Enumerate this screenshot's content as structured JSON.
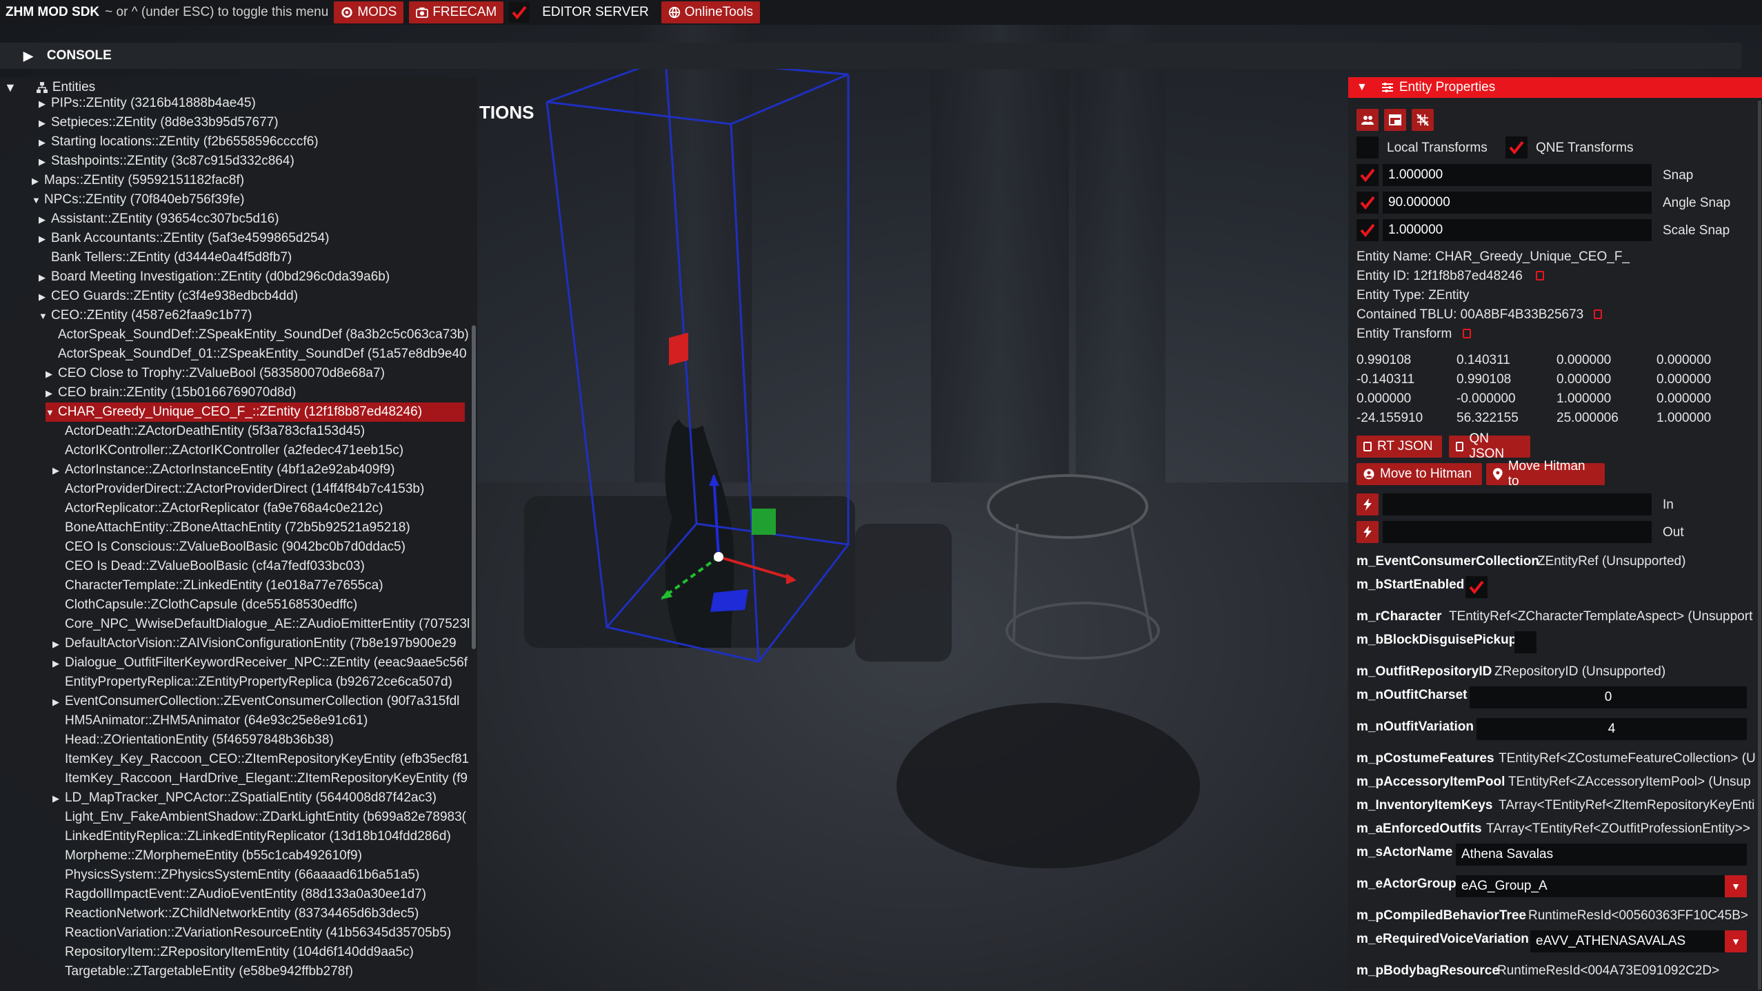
{
  "menubar": {
    "brand": "ZHM MOD SDK",
    "hint": "~ or ^ (under ESC) to toggle this menu",
    "mods": "MODS",
    "freecam": "FREECAM",
    "editor_server": "EDITOR SERVER",
    "online_tools": "OnlineTools",
    "accent": "#a81c1c"
  },
  "console": {
    "label": "CONSOLE"
  },
  "tree": {
    "header": "Entities",
    "rows": [
      {
        "text": "PIPs::ZEntity (3216b41888b4ae45)",
        "arrow": "collapsed"
      },
      {
        "text": "Setpieces::ZEntity (8d8e33b95d57677)",
        "arrow": "collapsed"
      },
      {
        "text": "Starting locations::ZEntity (f2b6558596ccccf6)",
        "arrow": "collapsed"
      },
      {
        "text": "Stashpoints::ZEntity (3c87c915d332c864)",
        "arrow": "collapsed"
      },
      {
        "text": "Maps::ZEntity (59592151182fac8f)",
        "arrow": "collapsed"
      },
      {
        "text": "NPCs::ZEntity (70f840eb756f39fe)",
        "arrow": "expanded"
      },
      {
        "text": "Assistant::ZEntity (93654cc307bc5d16)",
        "arrow": "collapsed"
      },
      {
        "text": "Bank Accountants::ZEntity (5af3e4599865d254)",
        "arrow": "collapsed"
      },
      {
        "text": "Bank Tellers::ZEntity (d3444e0a4f5d8fb7)",
        "arrow": "none"
      },
      {
        "text": "Board Meeting Investigation::ZEntity (d0bd296c0da39a6b)",
        "arrow": "collapsed"
      },
      {
        "text": "CEO Guards::ZEntity (c3f4e938edbcb4dd)",
        "arrow": "collapsed"
      },
      {
        "text": "CEO::ZEntity (4587e62faa9c1b77)",
        "arrow": "expanded"
      },
      {
        "text": "ActorSpeak_SoundDef::ZSpeakEntity_SoundDef (8a3b2c5c063ca73b)",
        "arrow": "none"
      },
      {
        "text": "ActorSpeak_SoundDef_01::ZSpeakEntity_SoundDef (51a57e8db9e40",
        "arrow": "none"
      },
      {
        "text": "CEO Close to Trophy::ZValueBool (583580070d8e68a7)",
        "arrow": "collapsed"
      },
      {
        "text": "CEO brain::ZEntity (15b0166769070d8d)",
        "arrow": "collapsed"
      },
      {
        "text": "CHAR_Greedy_Unique_CEO_F_::ZEntity (12f1f8b87ed48246)",
        "arrow": "expanded"
      },
      {
        "text": "ActorDeath::ZActorDeathEntity (5f3a783cfa153d45)",
        "arrow": "none"
      },
      {
        "text": "ActorIKController::ZActorIKController (a2fedec471eeb15c)",
        "arrow": "none"
      },
      {
        "text": "ActorInstance::ZActorInstanceEntity (4bf1a2e92ab409f9)",
        "arrow": "collapsed"
      },
      {
        "text": "ActorProviderDirect::ZActorProviderDirect (14ff4f84b7c4153b)",
        "arrow": "none"
      },
      {
        "text": "ActorReplicator::ZActorReplicator (fa9e768a4c0e212c)",
        "arrow": "none"
      },
      {
        "text": "BoneAttachEntity::ZBoneAttachEntity (72b5b92521a95218)",
        "arrow": "none"
      },
      {
        "text": "CEO Is Conscious::ZValueBoolBasic (9042bc0b7d0ddac5)",
        "arrow": "none"
      },
      {
        "text": "CEO Is Dead::ZValueBoolBasic (cf4a7fedf033bc03)",
        "arrow": "none"
      },
      {
        "text": "CharacterTemplate::ZLinkedEntity (1e018a77e7655ca)",
        "arrow": "none"
      },
      {
        "text": "ClothCapsule::ZClothCapsule (dce55168530edffc)",
        "arrow": "none"
      },
      {
        "text": "Core_NPC_WwiseDefaultDialogue_AE::ZAudioEmitterEntity (707523l",
        "arrow": "none"
      },
      {
        "text": "DefaultActorVision::ZAIVisionConfigurationEntity (7b8e197b900e29",
        "arrow": "collapsed"
      },
      {
        "text": "Dialogue_OutfitFilterKeywordReceiver_NPC::ZEntity (eeac9aae5c56f",
        "arrow": "collapsed"
      },
      {
        "text": "EntityPropertyReplica::ZEntityPropertyReplica (b92672ce6ca507d)",
        "arrow": "none"
      },
      {
        "text": "EventConsumerCollection::ZEventConsumerCollection (90f7a315fdl",
        "arrow": "collapsed"
      },
      {
        "text": "HM5Animator::ZHM5Animator (64e93c25e8e91c61)",
        "arrow": "none"
      },
      {
        "text": "Head::ZOrientationEntity (5f46597848b36b38)",
        "arrow": "none"
      },
      {
        "text": "ItemKey_Key_Raccoon_CEO::ZItemRepositoryKeyEntity (efb35ecf81",
        "arrow": "none"
      },
      {
        "text": "ItemKey_Raccoon_HardDrive_Elegant::ZItemRepositoryKeyEntity (f9",
        "arrow": "none"
      },
      {
        "text": "LD_MapTracker_NPCActor::ZSpatialEntity (5644008d87f42ac3)",
        "arrow": "collapsed"
      },
      {
        "text": "Light_Env_FakeAmbientShadow::ZDarkLightEntity (b699a82e78983(",
        "arrow": "none"
      },
      {
        "text": "LinkedEntityReplica::ZLinkedEntityReplicator (13d18b104fdd286d)",
        "arrow": "none"
      },
      {
        "text": "Morpheme::ZMorphemeEntity (b55c1cab492610f9)",
        "arrow": "none"
      },
      {
        "text": "PhysicsSystem::ZPhysicsSystemEntity (66aaaad61b6a51a5)",
        "arrow": "none"
      },
      {
        "text": "RagdollImpactEvent::ZAudioEventEntity (88d133a0a30ee1d7)",
        "arrow": "none"
      },
      {
        "text": "ReactionNetwork::ZChildNetworkEntity (83734465d6b3dec5)",
        "arrow": "none"
      },
      {
        "text": "ReactionVariation::ZVariationResourceEntity (41b56345d35705b5)",
        "arrow": "none"
      },
      {
        "text": "RepositoryItem::ZRepositoryItemEntity (104d6f140dd9aa5c)",
        "arrow": "none"
      },
      {
        "text": "Targetable::ZTargetableEntity (e58be942ffbb278f)",
        "arrow": "none"
      }
    ]
  },
  "partial_title": "TIONS",
  "props": {
    "title": "Entity Properties",
    "local_transforms": "Local Transforms",
    "qne_transforms": "QNE Transforms",
    "snap_value": "1.000000",
    "snap_label": "Snap",
    "angle_snap_value": "90.000000",
    "angle_snap_label": "Angle Snap",
    "scale_snap_value": "1.000000",
    "scale_snap_label": "Scale Snap",
    "entity_name": "Entity Name: CHAR_Greedy_Unique_CEO_F_",
    "entity_id": "Entity ID: 12f1f8b87ed48246",
    "entity_type": "Entity Type: ZEntity",
    "contained_tblu": "Contained TBLU: 00A8BF4B33B25673",
    "entity_transform": "Entity Transform",
    "matrix": [
      [
        "0.990108",
        "0.140311",
        "0.000000",
        "0.000000"
      ],
      [
        "-0.140311",
        "0.990108",
        "0.000000",
        "0.000000"
      ],
      [
        "0.000000",
        "-0.000000",
        "1.000000",
        "0.000000"
      ],
      [
        "-24.155910",
        "56.322155",
        "25.000006",
        "1.000000"
      ]
    ],
    "rt_json": "RT JSON",
    "qn_json": "QN JSON",
    "move_to_hitman": "Move to Hitman",
    "move_hitman_to": "Move Hitman to",
    "in_label": "In",
    "out_label": "Out",
    "properties": {
      "event_consumer_label": "m_EventConsumerCollection",
      "event_consumer_value": "ZEntityRef (Unsupported)",
      "start_enabled_label": "m_bStartEnabled",
      "character_label": "m_rCharacter",
      "character_value": "TEntityRef<ZCharacterTemplateAspect> (Unsupport",
      "block_disguise_label": "m_bBlockDisguisePickup",
      "outfit_repo_label": "m_OutfitRepositoryID",
      "outfit_repo_value": "ZRepositoryID (Unsupported)",
      "outfit_charset_label": "m_nOutfitCharset",
      "outfit_charset_value": "0",
      "outfit_variation_label": "m_nOutfitVariation",
      "outfit_variation_value": "4",
      "costume_label": "m_pCostumeFeatures",
      "costume_value": "TEntityRef<ZCostumeFeatureCollection> (U",
      "accessory_label": "m_pAccessoryItemPool",
      "accessory_value": "TEntityRef<ZAccessoryItemPool> (Unsup",
      "inventory_label": "m_InventoryItemKeys",
      "inventory_value": "TArray<TEntityRef<ZItemRepositoryKeyEnti",
      "enforced_label": "m_aEnforcedOutfits",
      "enforced_value": "TArray<TEntityRef<ZOutfitProfessionEntity>>",
      "actor_name_label": "m_sActorName",
      "actor_name_value": "Athena Savalas",
      "actor_group_label": "m_eActorGroup",
      "actor_group_value": "eAG_Group_A",
      "behavior_label": "m_pCompiledBehaviorTree",
      "behavior_value": "RuntimeResId<00560363FF10C45B>",
      "voice_label": "m_eRequiredVoiceVariation",
      "voice_value": "eAVV_ATHENASAVALAS",
      "bodybag_label": "m_pBodybagResource",
      "bodybag_value": "RuntimeResId<004A73E091092C2D>"
    },
    "accent": "#e8161c"
  }
}
